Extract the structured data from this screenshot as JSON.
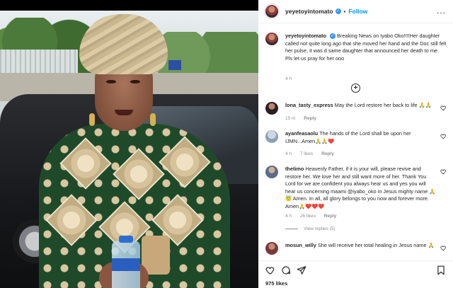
{
  "post_header": {
    "username": "yeyetoyintomato",
    "separator": "•",
    "follow_label": "Follow",
    "more_label": "..."
  },
  "caption": {
    "username": "yeyetoyintomato",
    "text": "Breaking News on Iyabo Oko!!!!Her daughter called not quite long ago that she moved her hand and the Doc still felt her pulse, it was d same daughter that announced her death to me. Pls let us pray for her ooo",
    "time": "4 h"
  },
  "comments": [
    {
      "username": "lona_tasty_express",
      "text": "May the Lord restore her back to life 🙏🙏",
      "time": "15 m",
      "likes": "",
      "reply_label": "Reply"
    },
    {
      "username": "ayanfeasaolu",
      "text": "The hands of the Lord shall be upon her IJMN...Amen🙏🙏❤️",
      "time": "4 h",
      "likes": "7 likes",
      "reply_label": "Reply"
    },
    {
      "username": "thetimo",
      "text": "Heavenly Father, if it is your will, please revive and restore her. We love her and still want more of her. Thank You Lord for we are confident you always hear us and yes you will hear us concerning maami @iyabo_oko in Jesus mighty name 🙏😇 Amen. In all, all glory belongs to you now and forever more. Amen🙏❤️❤️❤️",
      "time": "4 h",
      "likes": "26 likes",
      "reply_label": "Reply",
      "view_replies": "View replies (5)"
    },
    {
      "username": "mosun_willy",
      "text": "She will receive her total healing in Jesus name 🙏",
      "time": "",
      "likes": "",
      "reply_label": ""
    }
  ],
  "footer": {
    "likes": "975 likes"
  },
  "icons": {
    "like": "heart-icon",
    "comment": "comment-icon",
    "share": "share-icon",
    "save": "bookmark-icon",
    "load_more": "plus-circle-icon"
  },
  "colors": {
    "follow": "#0095f6",
    "verified": "#3897f0",
    "muted": "#8e8e8e"
  }
}
